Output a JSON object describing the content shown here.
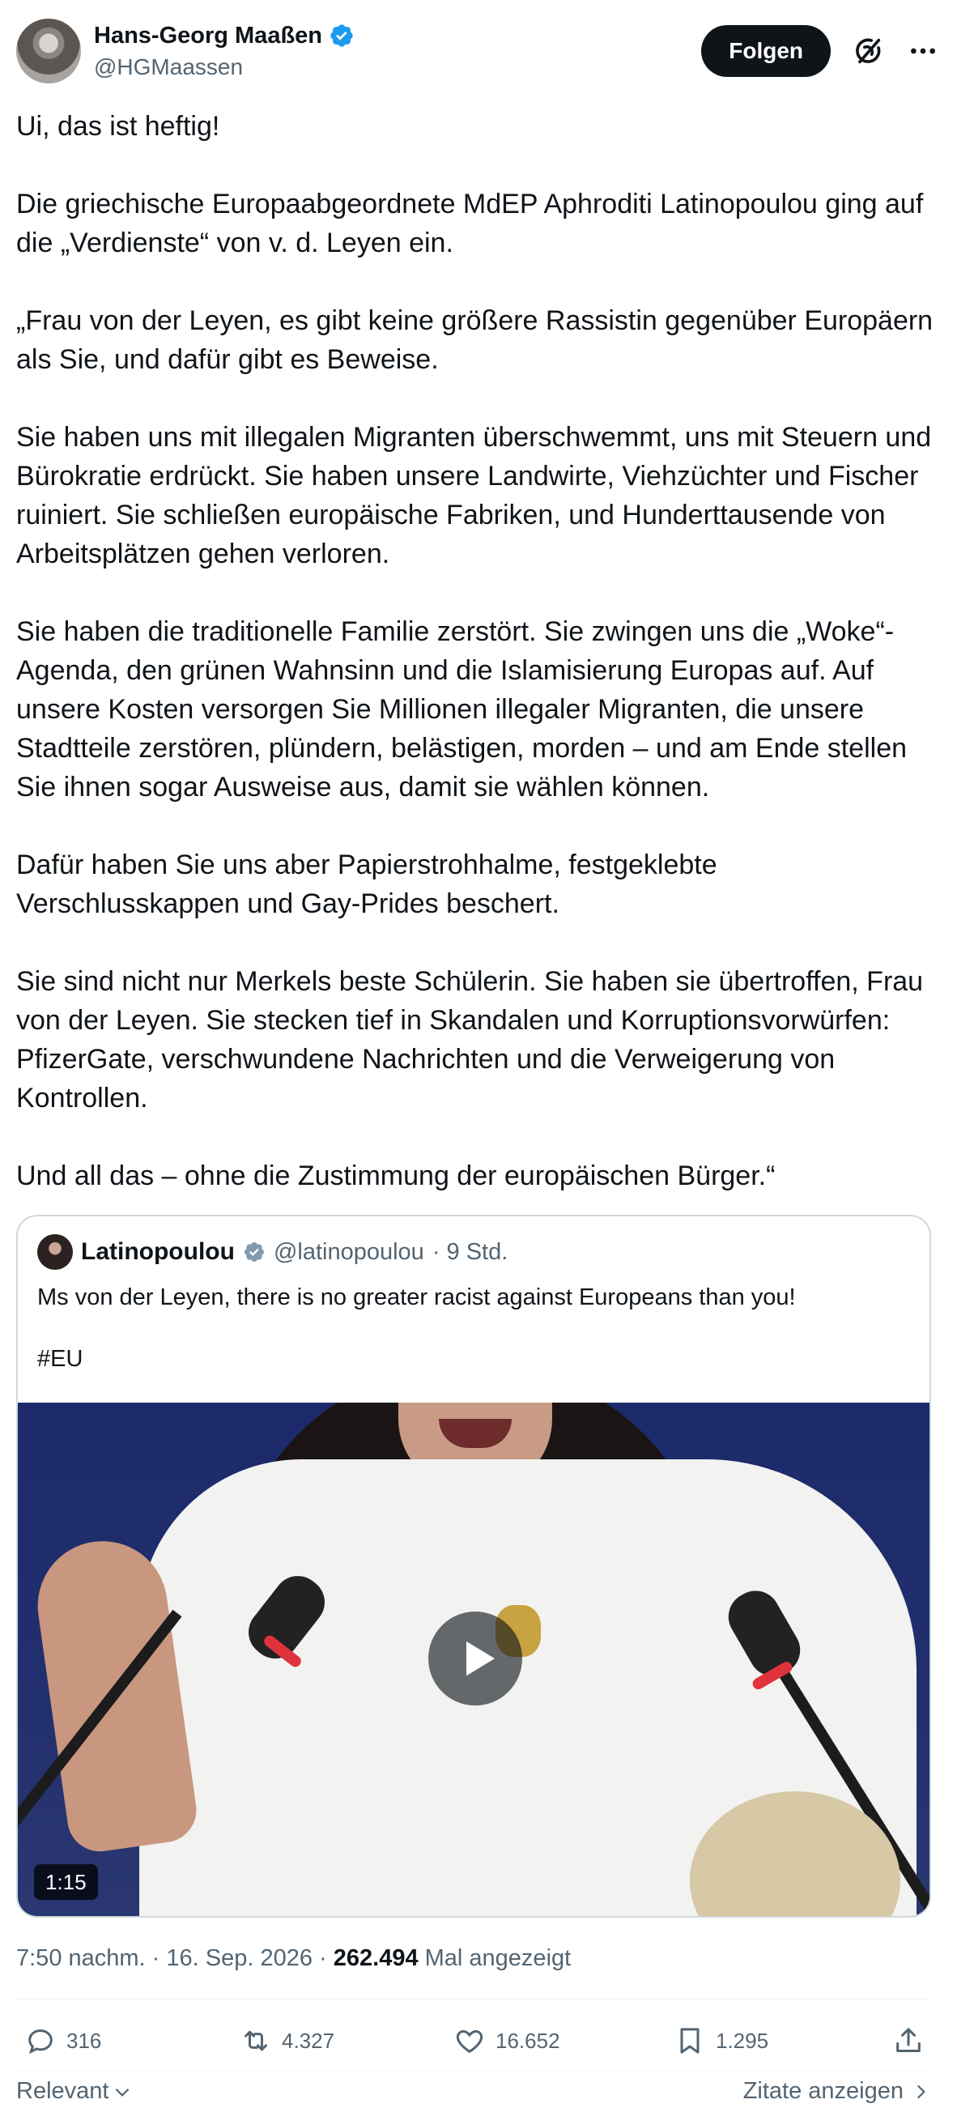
{
  "author": {
    "name": "Hans-Georg Maaßen",
    "handle": "@HGMaassen",
    "follow_label": "Folgen"
  },
  "tweet": {
    "paragraphs": [
      "Ui, das ist heftig!",
      "Die griechische Europaabgeordnete MdEP Aphroditi Latinopoulou ging auf die „Verdienste“ von v. d. Leyen ein.",
      "„Frau von der Leyen, es gibt keine größere Rassistin gegenüber Europäern als Sie, und dafür gibt es Beweise.",
      "Sie haben uns mit illegalen Migranten überschwemmt, uns mit Steuern und Bürokratie erdrückt. Sie haben unsere Landwirte, Viehzüchter und Fischer ruiniert. Sie schließen europäische Fabriken, und Hunderttausende von Arbeitsplätzen gehen verloren.",
      "Sie haben die traditionelle Familie zerstört. Sie zwingen uns die „Woke“-Agenda, den grünen Wahnsinn und die Islamisierung Europas auf. Auf unsere Kosten versorgen Sie Millionen illegaler Migranten, die unsere Stadtteile zerstören, plündern, belästigen, morden – und am Ende stellen Sie ihnen sogar Ausweise aus, damit sie wählen können.",
      "Dafür haben Sie uns aber Papierstrohhalme, festgeklebte Verschlusskappen und Gay-Prides beschert.",
      "Sie sind nicht nur Merkels beste Schülerin. Sie haben sie übertroffen, Frau von der Leyen. Sie stecken tief in Skandalen und Korruptionsvorwürfen: PfizerGate, verschwundene Nachrichten und die Verweigerung von Kontrollen.",
      "Und all das – ohne die Zustimmung der europäischen Bürger.“"
    ]
  },
  "quote": {
    "name": "Latinopoulou",
    "handle": "@latinopoulou",
    "time": "· 9 Std.",
    "text": "Ms von der Leyen, there is no greater racist against Europeans than you!",
    "hashtag": "#EU",
    "video_duration": "1:15"
  },
  "meta": {
    "time": "7:50 nachm. · 16. Sep. 2026 · ",
    "views": "262.494",
    "views_label": " Mal angezeigt"
  },
  "actions": {
    "replies": "316",
    "retweets": "4.327",
    "likes": "16.652",
    "bookmarks": "1.295"
  },
  "footer": {
    "sort_label": "Relevant",
    "quotes_label": "Zitate anzeigen"
  },
  "colors": {
    "verified": "#1d9bf0",
    "text": "#0f1419",
    "secondary": "#536471",
    "border": "#cfd9de"
  }
}
